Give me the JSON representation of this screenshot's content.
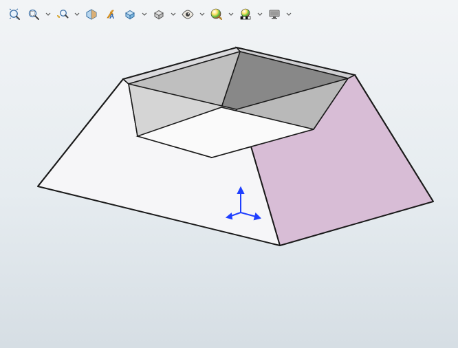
{
  "toolbar": {
    "zoom_to_fit": "Zoom to Fit",
    "zoom_to_area": "Zoom to Area",
    "previous_view": "Previous View",
    "section_view": "Section View",
    "dynamic_annotation": "Dynamic Annotation Views",
    "view_orientation": "View Orientation",
    "display_style": "Display Style",
    "hide_show": "Hide / Show Items",
    "edit_appearance": "Edit Appearance",
    "apply_scene": "Apply Scene",
    "view_settings": "View Settings"
  },
  "viewport": {
    "model_front_color": "#f6f6f8",
    "model_side_color": "#d8bdd6",
    "model_inner_back": "#888888",
    "model_inner_side": "#b9b9b9",
    "model_floor": "#fafafa",
    "triad_color": "#1f3fff"
  }
}
